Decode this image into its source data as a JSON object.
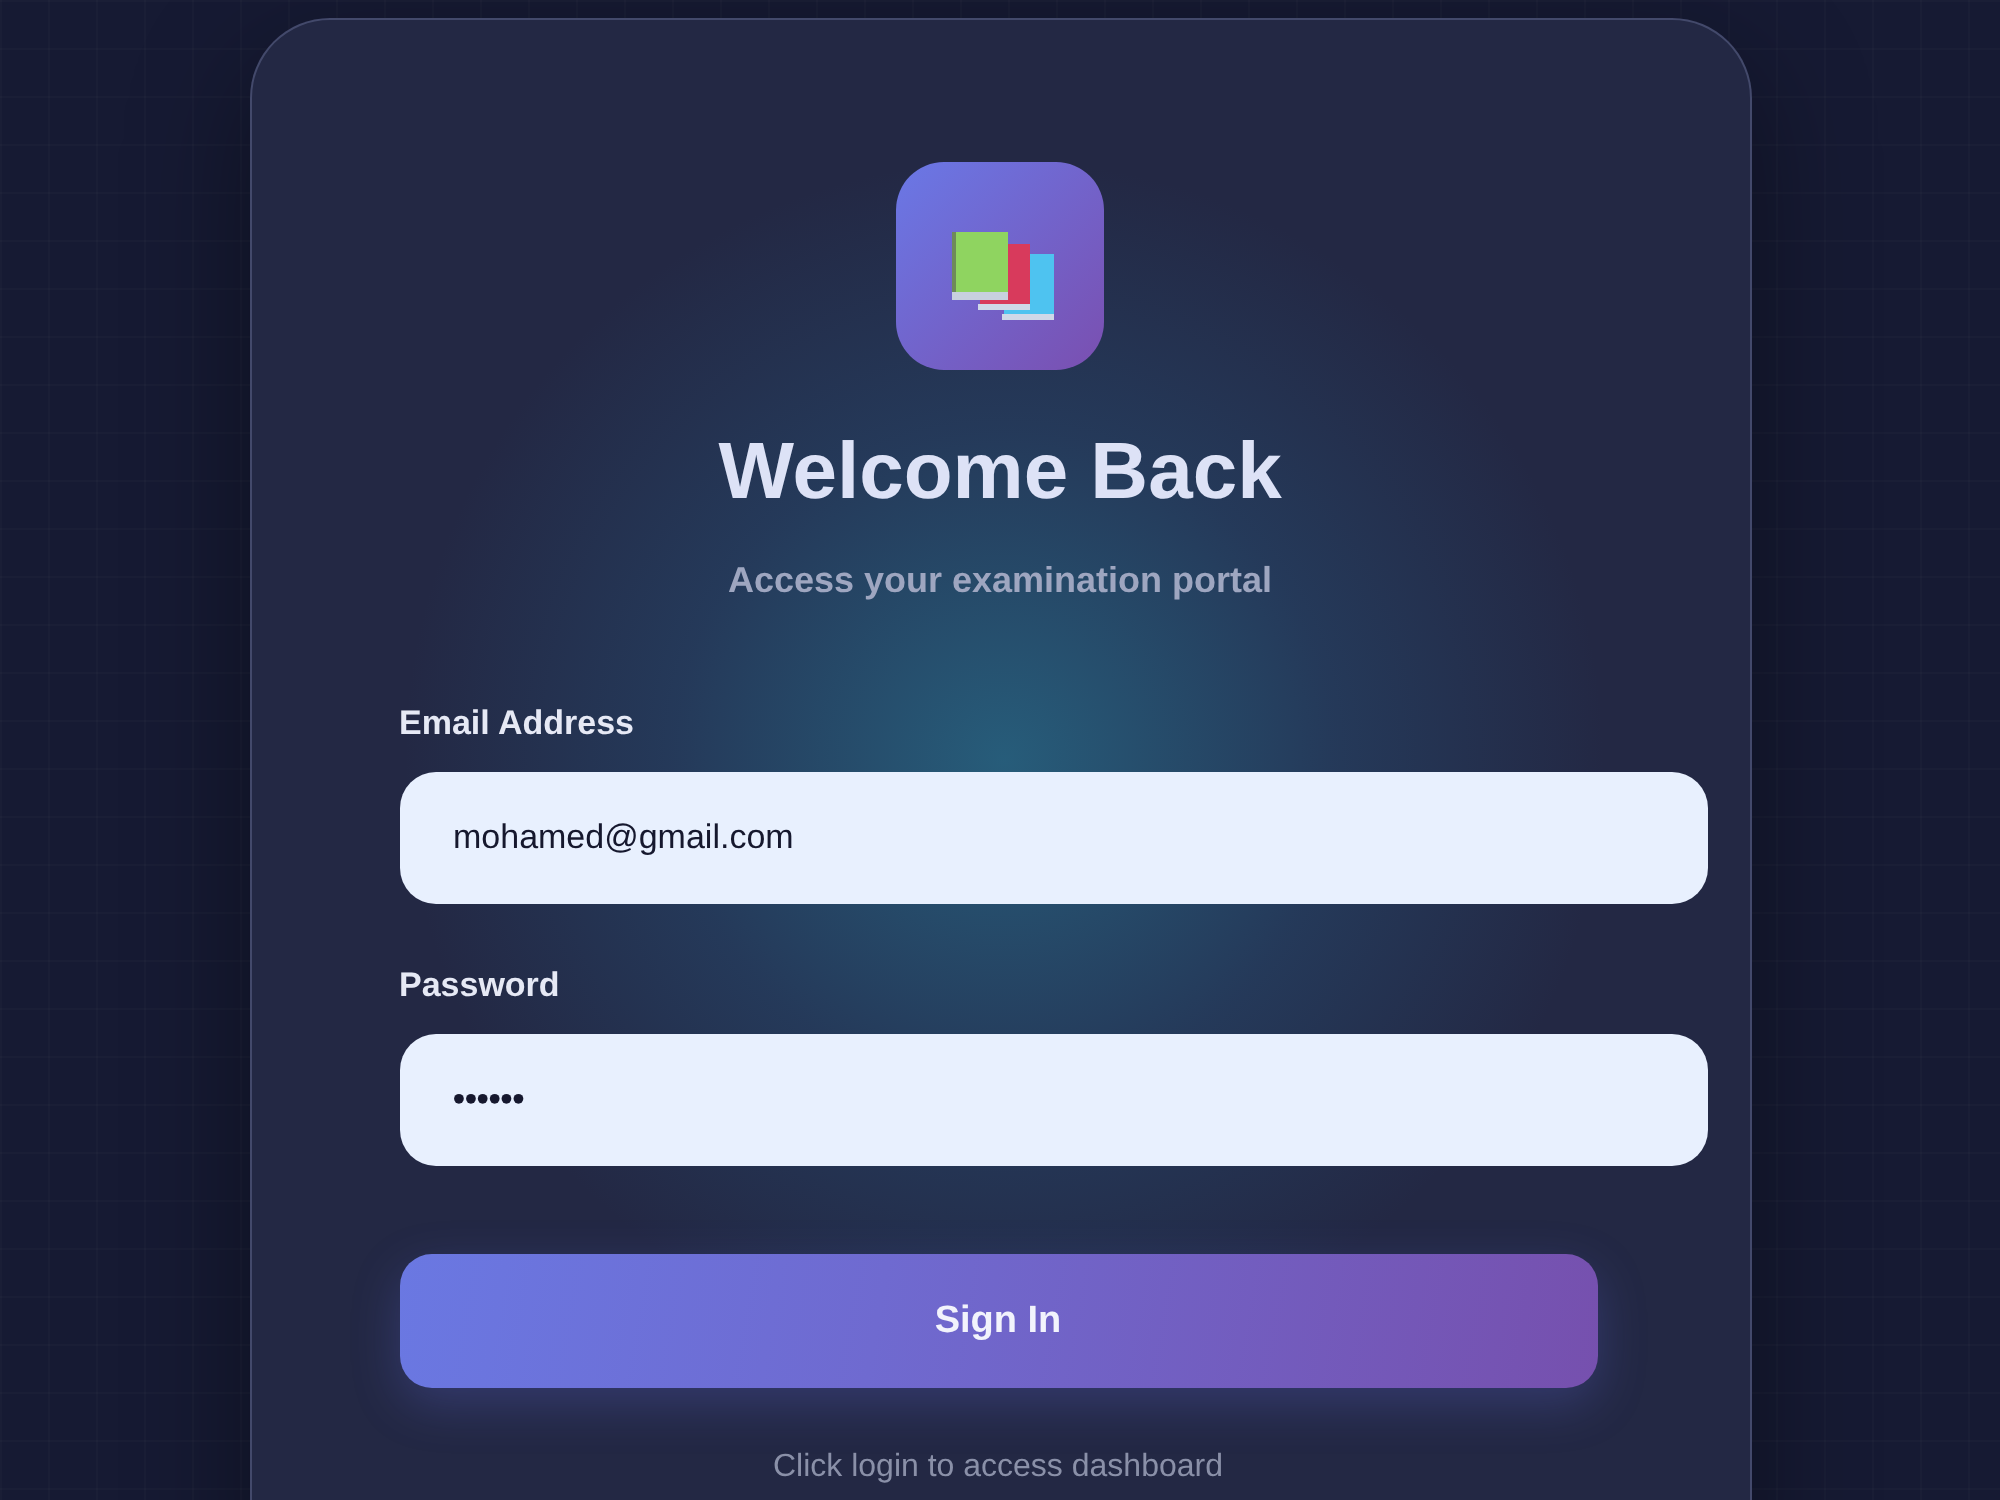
{
  "header": {
    "title": "Welcome Back",
    "subtitle": "Access your examination portal"
  },
  "form": {
    "fields": [
      {
        "kind": "email",
        "label": "Email Address",
        "value": "mohamed@gmail.com"
      },
      {
        "kind": "password",
        "label": "Password",
        "value": "••••••"
      }
    ],
    "submit": {
      "label": "Sign In"
    },
    "hint": "Click login to access dashboard"
  }
}
